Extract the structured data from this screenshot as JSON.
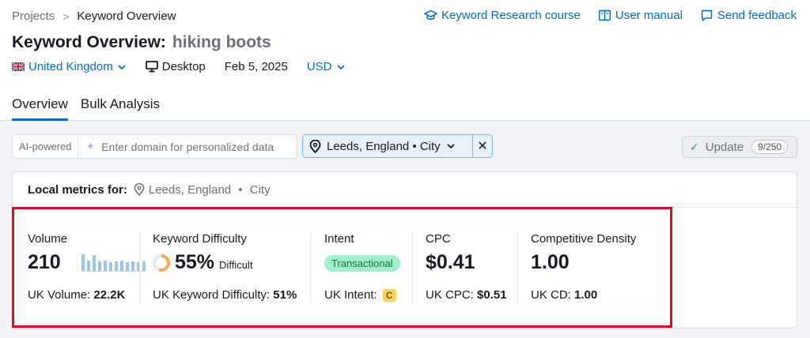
{
  "breadcrumb": {
    "root": "Projects",
    "separator": ">",
    "current": "Keyword Overview"
  },
  "header_links": {
    "course": "Keyword Research course",
    "manual": "User manual",
    "feedback": "Send feedback"
  },
  "title": {
    "prefix": "Keyword Overview:",
    "keyword": "hiking boots"
  },
  "filters": {
    "database": "United Kingdom",
    "device": "Desktop",
    "date": "Feb 5, 2025",
    "currency": "USD"
  },
  "tabs": [
    {
      "label": "Overview",
      "active": true
    },
    {
      "label": "Bulk Analysis",
      "active": false
    }
  ],
  "ai_search": {
    "label": "AI-powered",
    "placeholder": "Enter domain for personalized data"
  },
  "location_filter": {
    "label": "Leeds, England • City"
  },
  "update": {
    "label": "Update",
    "count": "9/250"
  },
  "card": {
    "heading": "Local metrics for:",
    "location": "Leeds, England",
    "location_type": "City"
  },
  "metrics": {
    "volume": {
      "label": "Volume",
      "value": "210",
      "sub_label": "UK Volume:",
      "sub_value": "22.2K",
      "trend": [
        0.95,
        0.6,
        0.9,
        0.55,
        0.6,
        0.5,
        0.55,
        0.6,
        0.5,
        0.55,
        0.5,
        0.55
      ]
    },
    "kd": {
      "label": "Keyword Difficulty",
      "value": "55%",
      "level": "Difficult",
      "percent": 55,
      "sub_label": "UK Keyword Difficulty:",
      "sub_value": "51%"
    },
    "intent": {
      "label": "Intent",
      "value": "Transactional",
      "sub_label": "UK Intent:",
      "sub_value": "C"
    },
    "cpc": {
      "label": "CPC",
      "value": "$0.41",
      "sub_label": "UK CPC:",
      "sub_value": "$0.51"
    },
    "cd": {
      "label": "Competitive Density",
      "value": "1.00",
      "sub_label": "UK CD:",
      "sub_value": "1.00"
    }
  },
  "colors": {
    "accent": "#006dca",
    "highlight_border": "#d0101a",
    "intent_bg": "#9ef2c9",
    "kd_orange": "#f3a94a"
  }
}
